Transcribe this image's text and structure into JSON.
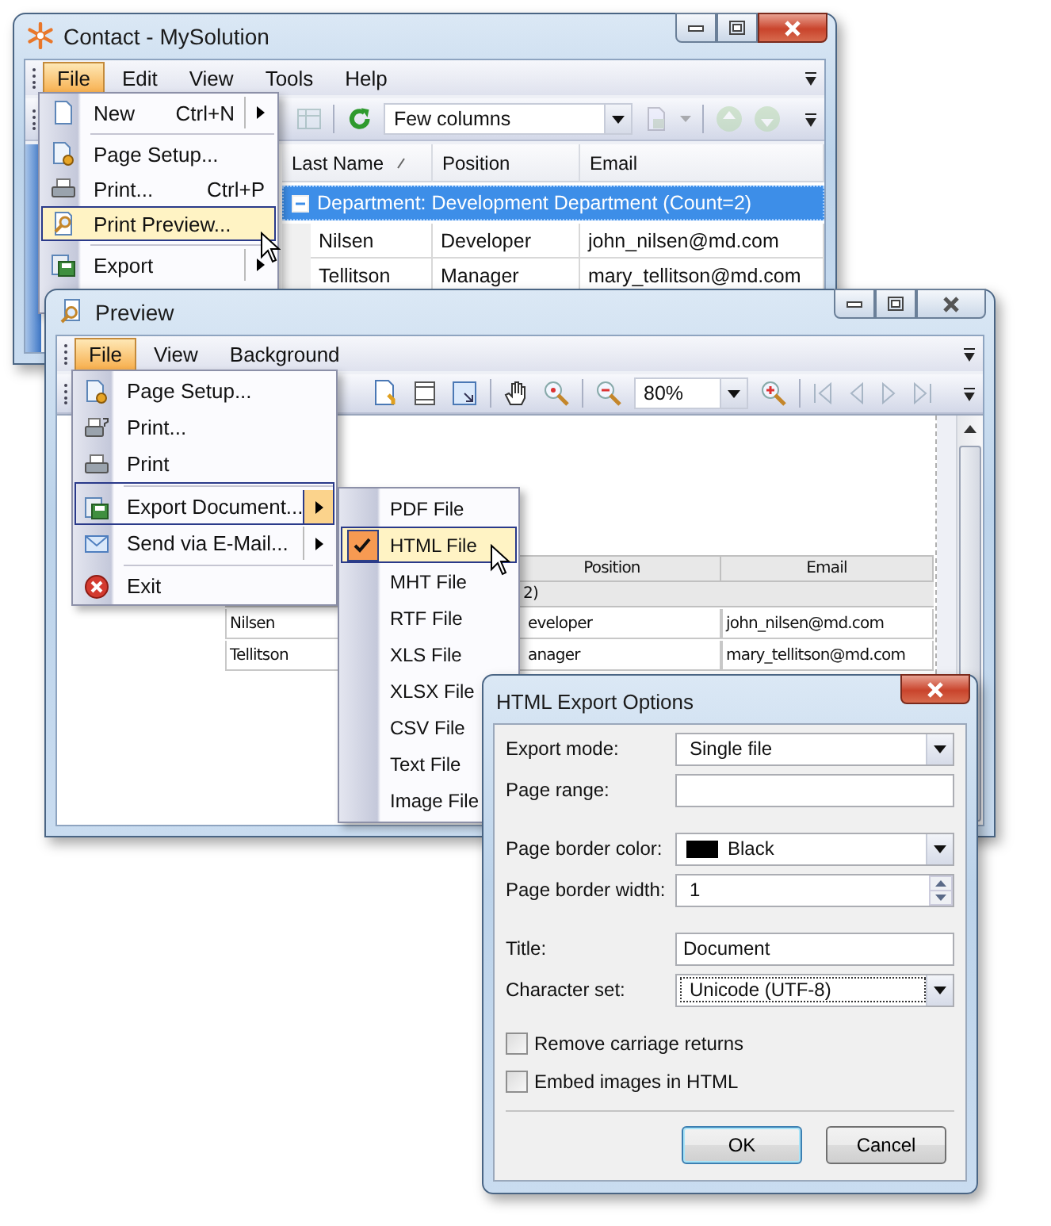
{
  "main_window": {
    "title": "Contact - MySolution",
    "menu": [
      {
        "label": "File",
        "selected": true
      },
      {
        "label": "Edit",
        "selected": false
      },
      {
        "label": "View",
        "selected": false
      },
      {
        "label": "Tools",
        "selected": false
      },
      {
        "label": "Help",
        "selected": false
      }
    ],
    "view_combo": "Few columns",
    "file_menu": [
      {
        "label": "New",
        "shortcut": "Ctrl+N",
        "submenu": true,
        "selected": false,
        "separator_before": false
      },
      {
        "label": "Page Setup...",
        "submenu": false,
        "selected": false,
        "separator_before": true
      },
      {
        "label": "Print...",
        "shortcut": "Ctrl+P",
        "submenu": false,
        "selected": false,
        "separator_before": false
      },
      {
        "label": "Print Preview...",
        "submenu": false,
        "selected": true,
        "separator_before": false
      },
      {
        "label": "Export",
        "submenu": true,
        "selected": false,
        "separator_before": true
      }
    ],
    "grid": {
      "columns": [
        "Last Name",
        "Position",
        "Email"
      ],
      "group_row": "Department: Development Department (Count=2)",
      "rows": [
        [
          "Nilsen",
          "Developer",
          "john_nilsen@md.com"
        ],
        [
          "Tellitson",
          "Manager",
          "mary_tellitson@md.com"
        ]
      ]
    }
  },
  "preview_window": {
    "title": "Preview",
    "menu": [
      {
        "label": "File",
        "selected": true
      },
      {
        "label": "View",
        "selected": false
      },
      {
        "label": "Background",
        "selected": false
      }
    ],
    "zoom": "80%",
    "file_menu": [
      {
        "label": "Page Setup...",
        "submenu": false,
        "selected": false,
        "separator_before": false
      },
      {
        "label": "Print...",
        "submenu": false,
        "selected": false,
        "separator_before": false
      },
      {
        "label": "Print",
        "submenu": false,
        "selected": false,
        "separator_before": false
      },
      {
        "label": "Export Document...",
        "submenu": true,
        "selected": true,
        "separator_before": true
      },
      {
        "label": "Send via E-Mail...",
        "submenu": true,
        "selected": false,
        "separator_before": false
      },
      {
        "label": "Exit",
        "submenu": false,
        "selected": false,
        "separator_before": true
      }
    ],
    "export_menu": [
      {
        "label": "PDF File",
        "checked": false,
        "selected": false
      },
      {
        "label": "HTML File",
        "checked": true,
        "selected": true
      },
      {
        "label": "MHT File",
        "checked": false,
        "selected": false
      },
      {
        "label": "RTF File",
        "checked": false,
        "selected": false
      },
      {
        "label": "XLS File",
        "checked": false,
        "selected": false
      },
      {
        "label": "XLSX File",
        "checked": false,
        "selected": false
      },
      {
        "label": "CSV File",
        "checked": false,
        "selected": false
      },
      {
        "label": "Text File",
        "checked": false,
        "selected": false
      },
      {
        "label": "Image File",
        "checked": false,
        "selected": false
      }
    ],
    "page_table": {
      "columns": [
        "",
        "Position",
        "Email"
      ],
      "group_row": "2)",
      "rows": [
        [
          "Nilsen",
          "eveloper",
          "john_nilsen@md.com"
        ],
        [
          "Tellitson",
          "anager",
          "mary_tellitson@md.com"
        ]
      ]
    }
  },
  "dialog": {
    "title": "HTML Export Options",
    "field_groups": [
      [
        {
          "kind": "dropdown",
          "label": "Export mode:",
          "value": "Single file",
          "focused": false
        },
        {
          "kind": "text",
          "label": "Page range:",
          "focused": false
        }
      ],
      [
        {
          "kind": "color",
          "label": "Page border color:",
          "value": "Black",
          "color": "#000000",
          "focused": false
        },
        {
          "kind": "spinner",
          "label": "Page border width:",
          "value": "1",
          "focused": false
        }
      ],
      [
        {
          "kind": "text",
          "label": "Title:",
          "value": "Document",
          "focused": false
        },
        {
          "kind": "dropdown",
          "label": "Character set:",
          "value": "Unicode (UTF-8)",
          "focused": true
        }
      ]
    ],
    "checkboxes": [
      {
        "label": "Remove carriage returns",
        "checked": false
      },
      {
        "label": "Embed images in HTML",
        "checked": false
      }
    ],
    "buttons": [
      {
        "label": "OK",
        "default": true
      },
      {
        "label": "Cancel",
        "default": false
      }
    ]
  }
}
